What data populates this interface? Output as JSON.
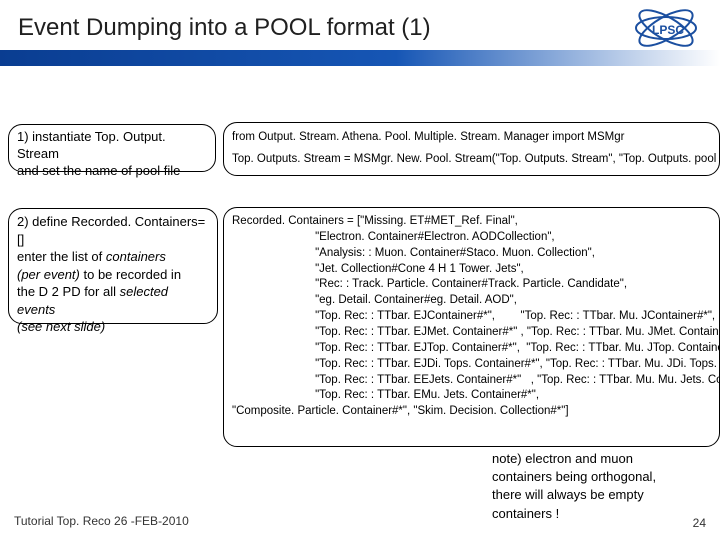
{
  "title": "Event Dumping into a POOL format  (1)",
  "logo_text": "LPSC",
  "box1": {
    "line1": "1) instantiate Top. Output. Stream",
    "line2": "and set the name of pool file"
  },
  "box2": {
    "line1": "2) define Recorded. Containers=[]",
    "line2_a": "enter the list of ",
    "line2_b": "containers",
    "line3_a": "(per event)",
    "line3_b": " to be recorded in",
    "line4_a": "the D 2 PD for all ",
    "line4_b": "selected events",
    "line5": "(see next slide)"
  },
  "box3": {
    "line1": "from Output. Stream. Athena. Pool. Multiple. Stream. Manager import MSMgr",
    "line2": "Top. Outputs. Stream = MSMgr. New. Pool. Stream(\"Top. Outputs. Stream\", \"Top. Outputs. pool"
  },
  "box4": {
    "l1": "Recorded. Containers = [\"Missing. ET#MET_Ref. Final\",",
    "l2": "                          \"Electron. Container#Electron. AODCollection\",",
    "l3": "                          \"Analysis: : Muon. Container#Staco. Muon. Collection\",",
    "l4": "                          \"Jet. Collection#Cone 4 H 1 Tower. Jets\",",
    "l5": "                          \"Rec: : Track. Particle. Container#Track. Particle. Candidate\",",
    "l6": "                          \"eg. Detail. Container#eg. Detail. AOD\",",
    "l7": "                          \"Top. Rec: : TTbar. EJContainer#*\",        \"Top. Rec: : TTbar. Mu. JContainer#*\",",
    "l8": "                          \"Top. Rec: : TTbar. EJMet. Container#*\" , \"Top. Rec: : TTbar. Mu. JMet. Containera",
    "l9": "                          \"Top. Rec: : TTbar. EJTop. Container#*\",  \"Top. Rec: : TTbar. Mu. JTop. Container#",
    "l10": "                          \"Top. Rec: : TTbar. EJDi. Tops. Container#*\", \"Top. Rec: : TTbar. Mu. JDi. Tops. Cont",
    "l11": "                          \"Top. Rec: : TTbar. EEJets. Container#*\"   , \"Top. Rec: : TTbar. Mu. Mu. Jets. Conta",
    "l12": "                          \"Top. Rec: : TTbar. EMu. Jets. Container#*\",",
    "l13": "\"Composite. Particle. Container#*\", \"Skim. Decision. Collection#*\"]"
  },
  "note": {
    "l1": "note) electron and muon",
    "l2": "containers being orthogonal,",
    "l3": "there will always be empty",
    "l4": "containers !"
  },
  "footer": "Tutorial Top. Reco 26 -FEB-2010",
  "pagenum": "24"
}
